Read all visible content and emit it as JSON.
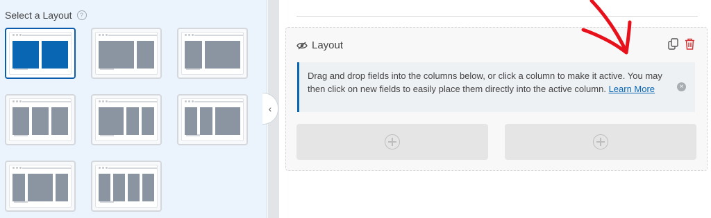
{
  "sidebar": {
    "title": "Select a Layout",
    "help_icon": "?"
  },
  "layouts": [
    {
      "name": "50/50",
      "columns": [
        50,
        50
      ],
      "selected": true
    },
    {
      "name": "67/33",
      "columns": [
        67,
        33
      ],
      "selected": false
    },
    {
      "name": "33/67",
      "columns": [
        33,
        67
      ],
      "selected": false
    },
    {
      "name": "33/33/33",
      "columns": [
        33,
        33,
        33
      ],
      "selected": false
    },
    {
      "name": "50/25/25",
      "columns": [
        50,
        25,
        25
      ],
      "selected": false
    },
    {
      "name": "25/25/50",
      "columns": [
        25,
        25,
        50
      ],
      "selected": false
    },
    {
      "name": "25/50/25",
      "columns": [
        25,
        50,
        25
      ],
      "selected": false
    },
    {
      "name": "25/25/25/25",
      "columns": [
        25,
        25,
        25,
        25
      ],
      "selected": false
    }
  ],
  "collapse_toggle": "‹",
  "layout_field": {
    "title": "Layout",
    "notice_text": "Drag and drop fields into the columns below, or click a column to make it active. You may then click on new fields to easily place them directly into the active column.",
    "notice_link": "Learn More",
    "close_glyph": "×"
  },
  "colors": {
    "accent": "#0866b2",
    "delete": "#d63638",
    "annotation": "#e8101a"
  }
}
